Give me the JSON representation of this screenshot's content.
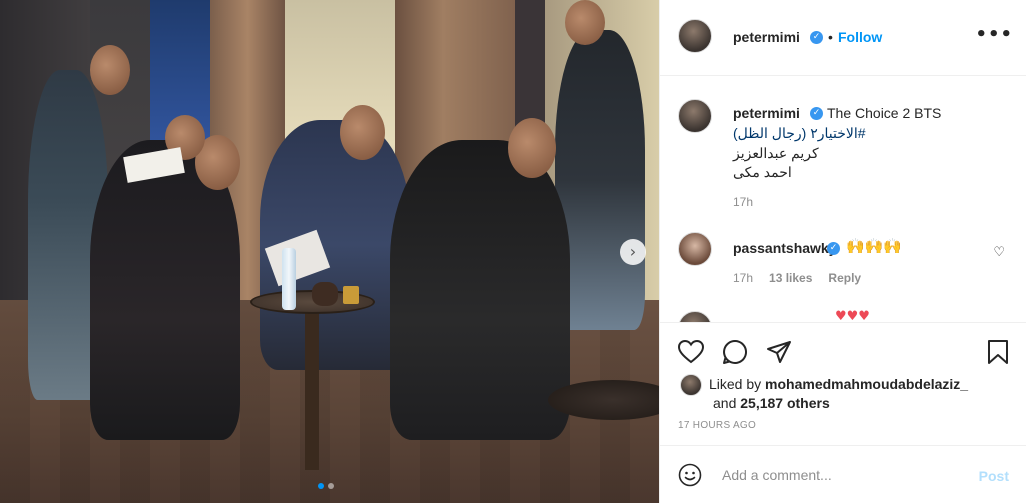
{
  "post": {
    "image_alt": "",
    "carousel": {
      "dot_count": 2,
      "active_index": 0,
      "next_label": "›"
    }
  },
  "header": {
    "username": "petermimi",
    "separator": "•",
    "follow_label": "Follow",
    "more_label": "•••"
  },
  "caption": {
    "username": "petermimi",
    "title": "The Choice 2 BTS",
    "hashtag": "#الاختيار٢ (رجال الظل)",
    "line2": "كريم عبدالعزيز",
    "line3": "احمد مكى",
    "time": "17h"
  },
  "comment": {
    "username": "passantshawky",
    "text": "🙌🙌🙌",
    "time": "17h",
    "likes": "13 likes",
    "reply_label": "Reply"
  },
  "partial_comment": {
    "text": "♥♥♥"
  },
  "likes": {
    "prefix": "Liked by ",
    "liker": "mohamedmahmoudabdelaziz_",
    "and": "and ",
    "others": "25,187 others"
  },
  "timestamp": "17 HOURS AGO",
  "add_comment": {
    "placeholder": "Add a comment...",
    "post_label": "Post"
  },
  "colors": {
    "accent": "#0095f6",
    "verified": "#3897f0",
    "muted": "#8e8e8e",
    "post_disabled": "#b2dffc"
  },
  "icons": [
    "verified-icon",
    "more-icon",
    "heart-icon",
    "comment-icon",
    "share-icon",
    "bookmark-icon",
    "emoji-icon",
    "next-arrow-icon"
  ]
}
